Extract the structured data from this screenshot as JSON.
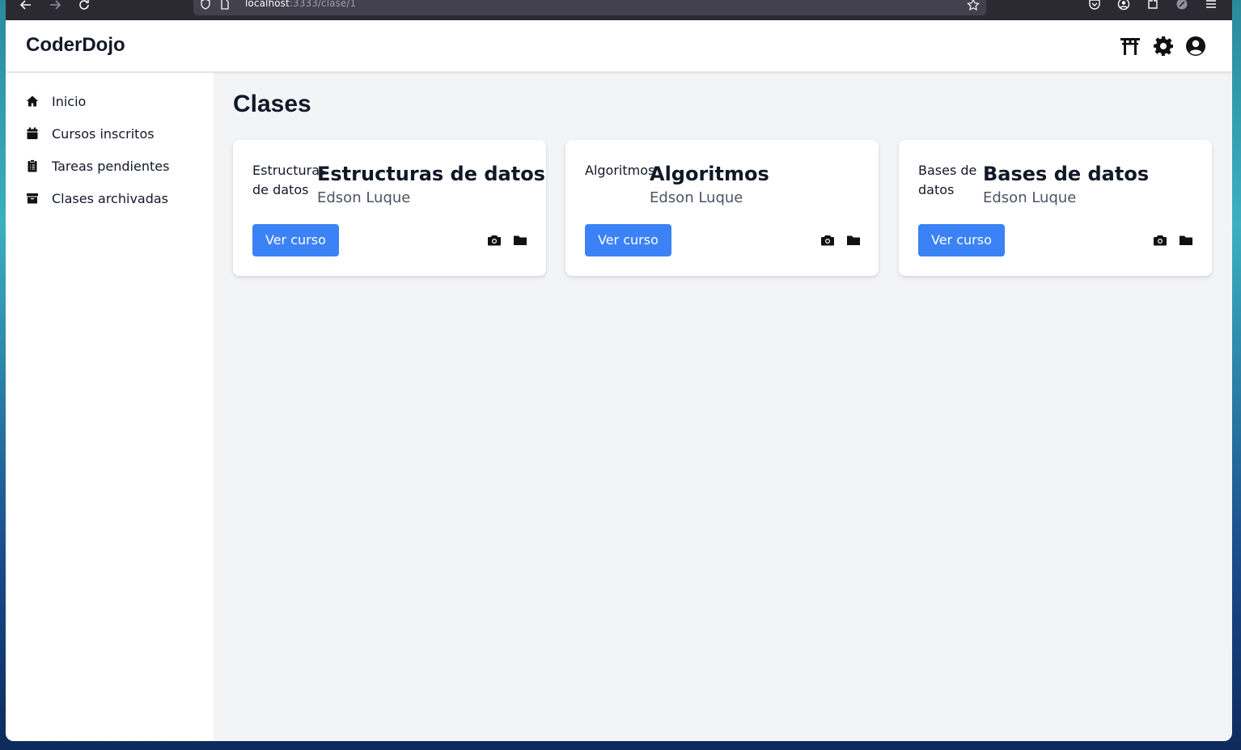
{
  "browser": {
    "url_host": "localhost",
    "url_path": ":3333/clase/1",
    "icons": [
      "back-arrow-icon",
      "forward-arrow-icon",
      "reload-icon",
      "shield-icon",
      "page-icon",
      "star-icon",
      "pocket-icon",
      "account-icon",
      "extensions-icon",
      "addon-icon",
      "menu-icon"
    ]
  },
  "header": {
    "brand": "CoderDojo",
    "icons": [
      "torii-gate-icon",
      "gear-icon",
      "user-circle-icon"
    ]
  },
  "sidebar": {
    "items": [
      {
        "label": "Inicio",
        "icon": "home-icon"
      },
      {
        "label": "Cursos inscritos",
        "icon": "calendar-icon"
      },
      {
        "label": "Tareas pendientes",
        "icon": "clipboard-list-icon"
      },
      {
        "label": "Clases archivadas",
        "icon": "archive-icon"
      }
    ]
  },
  "main": {
    "title": "Clases",
    "cards": [
      {
        "thumb_alt": "Estructuras de datos",
        "title": "Estructuras de datos",
        "teacher": "Edson Luque",
        "button": "Ver curso",
        "icons": [
          "camera-icon",
          "folder-icon"
        ]
      },
      {
        "thumb_alt": "Algoritmos",
        "title": "Algoritmos",
        "teacher": "Edson Luque",
        "button": "Ver curso",
        "icons": [
          "camera-icon",
          "folder-icon"
        ]
      },
      {
        "thumb_alt": "Bases de datos",
        "title": "Bases de datos",
        "teacher": "Edson Luque",
        "button": "Ver curso",
        "icons": [
          "camera-icon",
          "folder-icon"
        ]
      }
    ]
  },
  "colors": {
    "primary_button": "#3b82f6",
    "page_background": "#f3f4f6",
    "browser_chrome": "#2b2a33"
  }
}
